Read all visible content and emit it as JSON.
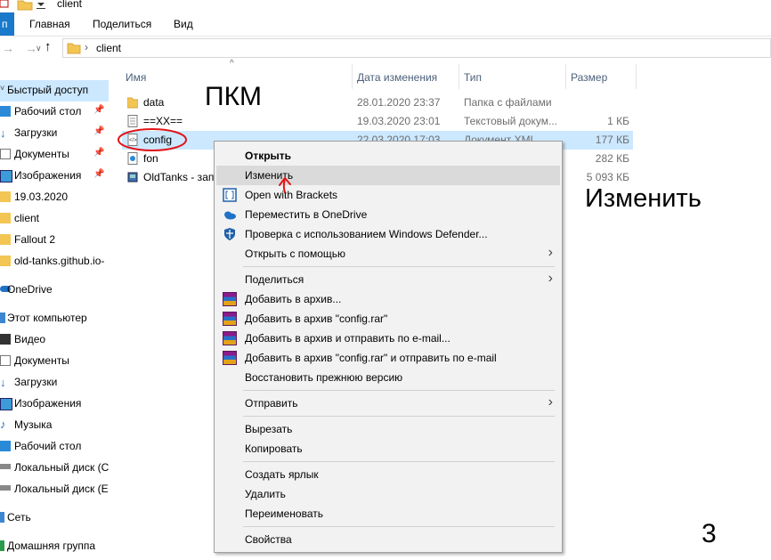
{
  "window": {
    "title": "client"
  },
  "ribbon": {
    "tabs": [
      "Главная",
      "Поделиться",
      "Вид"
    ]
  },
  "address": {
    "path": "client"
  },
  "nav": {
    "items": [
      {
        "label": "Быстрый доступ",
        "icon": "star-icon",
        "pinned": false,
        "selected": true
      },
      {
        "label": "Рабочий стол",
        "icon": "desktop-icon",
        "pinned": true
      },
      {
        "label": "Загрузки",
        "icon": "download-icon",
        "pinned": true
      },
      {
        "label": "Документы",
        "icon": "documents-icon",
        "pinned": true
      },
      {
        "label": "Изображения",
        "icon": "pictures-icon",
        "pinned": true
      },
      {
        "label": "19.03.2020",
        "icon": "folder-icon",
        "pinned": false
      },
      {
        "label": "client",
        "icon": "folder-icon",
        "pinned": false
      },
      {
        "label": "Fallout 2",
        "icon": "folder-icon",
        "pinned": false
      },
      {
        "label": "old-tanks.github.io-",
        "icon": "folder-icon",
        "pinned": false
      },
      {
        "label": "OneDrive",
        "icon": "onedrive-icon",
        "pinned": false
      },
      {
        "label": "Этот компьютер",
        "icon": "computer-icon",
        "pinned": false
      },
      {
        "label": "Видео",
        "icon": "video-icon",
        "pinned": false
      },
      {
        "label": "Документы",
        "icon": "documents-icon",
        "pinned": false
      },
      {
        "label": "Загрузки",
        "icon": "download-icon",
        "pinned": false
      },
      {
        "label": "Изображения",
        "icon": "pictures-icon",
        "pinned": false
      },
      {
        "label": "Музыка",
        "icon": "music-icon",
        "pinned": false
      },
      {
        "label": "Рабочий стол",
        "icon": "desktop-icon",
        "pinned": false
      },
      {
        "label": "Локальный диск (С",
        "icon": "drive-icon",
        "pinned": false
      },
      {
        "label": "Локальный диск (E",
        "icon": "drive-icon",
        "pinned": false
      },
      {
        "label": "Сеть",
        "icon": "network-icon",
        "pinned": false
      },
      {
        "label": "Домашняя группа",
        "icon": "homegroup-icon",
        "pinned": false
      }
    ]
  },
  "columns": {
    "name": "Имя",
    "date": "Дата изменения",
    "type": "Тип",
    "size": "Размер"
  },
  "files": [
    {
      "name": "data",
      "date": "28.01.2020 23:37",
      "type": "Папка с файлами",
      "size": "",
      "icon": "folder-icon"
    },
    {
      "name": "==XX==",
      "date": "19.03.2020 23:01",
      "type": "Текстовый докум...",
      "size": "1 КБ",
      "icon": "text-file-icon"
    },
    {
      "name": "config",
      "date": "22.03.2020 17:03",
      "type": "Документ XML",
      "size": "177 КБ",
      "icon": "xml-file-icon",
      "selected": true
    },
    {
      "name": "fon",
      "date": "",
      "type": "",
      "size": "282 КБ",
      "icon": "image-file-icon"
    },
    {
      "name": "OldTanks - зап",
      "date": "",
      "type": "",
      "size": "5 093 КБ",
      "icon": "exe-file-icon"
    }
  ],
  "context_menu": {
    "groups": [
      [
        {
          "label": "Открыть",
          "bold": true
        },
        {
          "label": "Изменить",
          "hover": true
        },
        {
          "label": "Open with Brackets",
          "icon": "brackets-icon"
        },
        {
          "label": "Переместить в OneDrive",
          "icon": "onedrive-icon"
        },
        {
          "label": "Проверка с использованием Windows Defender...",
          "icon": "defender-icon"
        },
        {
          "label": "Открыть с помощью",
          "submenu": true
        }
      ],
      [
        {
          "label": "Поделиться",
          "submenu": true
        },
        {
          "label": "Добавить в архив...",
          "icon": "winrar-icon"
        },
        {
          "label": "Добавить в архив \"config.rar\"",
          "icon": "winrar-icon"
        },
        {
          "label": "Добавить в архив и отправить по e-mail...",
          "icon": "winrar-icon"
        },
        {
          "label": "Добавить в архив \"config.rar\" и отправить по e-mail",
          "icon": "winrar-icon"
        },
        {
          "label": "Восстановить прежнюю версию"
        }
      ],
      [
        {
          "label": "Отправить",
          "submenu": true
        }
      ],
      [
        {
          "label": "Вырезать"
        },
        {
          "label": "Копировать"
        }
      ],
      [
        {
          "label": "Создать ярлык"
        },
        {
          "label": "Удалить"
        },
        {
          "label": "Переименовать"
        }
      ],
      [
        {
          "label": "Свойства"
        }
      ]
    ]
  },
  "annotations": {
    "rclick": "ПКМ",
    "edit": "Изменить",
    "step": "3"
  },
  "colors": {
    "accent": "#1979ca",
    "selection": "#cce8ff",
    "menu_hover": "#dadada",
    "annotation_red": "#e0151a"
  }
}
